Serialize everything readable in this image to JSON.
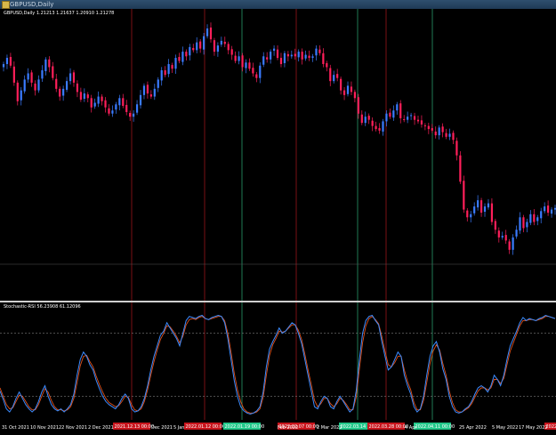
{
  "window": {
    "title": "GBPUSD,Daily"
  },
  "main_panel": {
    "header": "GBPUSD,Daily  1.21213 1.21637 1.20910 1.21278"
  },
  "sub_panel": {
    "header": "Stochastic-RSI 56.23908 61.12096"
  },
  "colors": {
    "bull": "#3a7bff",
    "bear": "#ff1f5a",
    "bg": "#000000",
    "stoch_main": "#3c8cff",
    "stoch_signal": "#e0521c",
    "vline_red": "#7a0f14",
    "vline_green": "#1f7a55",
    "tag_red": "#c8141c",
    "tag_green": "#22c88a"
  },
  "time_axis": {
    "labels": [
      "31 Oct 2021",
      "10 Nov 2021",
      "22 Nov 2021",
      "2 Dec 2021",
      "Dec 2021",
      "5 Jan",
      "Feb 2022",
      "2 Mar 2022",
      "4 Apr",
      "25 Apr 2022",
      "5 May 2022",
      "17 May 2022"
    ],
    "tags": [
      {
        "text": "2021.12.13 00:00",
        "color": "red"
      },
      {
        "text": "2022.01.12 00:00",
        "color": "red"
      },
      {
        "text": "2022.01.19 00:00",
        "color": "green"
      },
      {
        "text": "2022.02.07 00:00",
        "color": "red"
      },
      {
        "text": "2022.03.14 00:00",
        "color": "green"
      },
      {
        "text": "2022.03.28 00:00",
        "color": "red"
      },
      {
        "text": "2022.04.11 00:00",
        "color": "green"
      },
      {
        "text": "2022.05.25 00:00",
        "color": "red"
      }
    ]
  },
  "chart_data": [
    {
      "type": "candlestick",
      "symbol": "GBPUSD",
      "timeframe": "Daily",
      "last_bar": {
        "open": 1.21213,
        "high": 1.21637,
        "low": 1.2091,
        "close": 1.21278
      },
      "vertical_markers": [
        {
          "date": "2021.12.13",
          "color": "red"
        },
        {
          "date": "2022.01.12",
          "color": "red"
        },
        {
          "date": "2022.01.19",
          "color": "green"
        },
        {
          "date": "2022.02.07",
          "color": "red"
        },
        {
          "date": "2022.03.14",
          "color": "green"
        },
        {
          "date": "2022.03.28",
          "color": "red"
        },
        {
          "date": "2022.04.11",
          "color": "green"
        }
      ],
      "close_profile": [
        1.352,
        1.356,
        1.351,
        1.34,
        1.328,
        1.335,
        1.342,
        1.346,
        1.34,
        1.335,
        1.342,
        1.348,
        1.355,
        1.35,
        1.343,
        1.336,
        1.331,
        1.336,
        1.341,
        1.346,
        1.34,
        1.334,
        1.329,
        1.333,
        1.33,
        1.324,
        1.327,
        1.331,
        1.328,
        1.324,
        1.32,
        1.322,
        1.326,
        1.33,
        1.325,
        1.321,
        1.318,
        1.32,
        1.326,
        1.332,
        1.338,
        1.333,
        1.331,
        1.336,
        1.342,
        1.348,
        1.345,
        1.352,
        1.349,
        1.356,
        1.354,
        1.36,
        1.357,
        1.363,
        1.361,
        1.366,
        1.362,
        1.37,
        1.375,
        1.368,
        1.36,
        1.364,
        1.367,
        1.365,
        1.361,
        1.358,
        1.354,
        1.357,
        1.35,
        1.353,
        1.349,
        1.346,
        1.343,
        1.351,
        1.357,
        1.355,
        1.36,
        1.362,
        1.356,
        1.352,
        1.359,
        1.357,
        1.358,
        1.357,
        1.36,
        1.355,
        1.358,
        1.356,
        1.357,
        1.362,
        1.359,
        1.352,
        1.35,
        1.341,
        1.345,
        1.343,
        1.335,
        1.332,
        1.338,
        1.334,
        1.33,
        1.32,
        1.314,
        1.318,
        1.316,
        1.312,
        1.31,
        1.309,
        1.315,
        1.32,
        1.318,
        1.322,
        1.326,
        1.317,
        1.316,
        1.318,
        1.319,
        1.316,
        1.315,
        1.313,
        1.312,
        1.31,
        1.309,
        1.306,
        1.311,
        1.308,
        1.305,
        1.307,
        1.303,
        1.293,
        1.276,
        1.258,
        1.253,
        1.255,
        1.26,
        1.264,
        1.256,
        1.26,
        1.262,
        1.25,
        1.245,
        1.24,
        1.241,
        1.238,
        1.232,
        1.24,
        1.245,
        1.253,
        1.246,
        1.25,
        1.255,
        1.25,
        1.253,
        1.257,
        1.26,
        1.256,
        1.258,
        1.259
      ],
      "y_range": [
        1.225,
        1.375
      ]
    },
    {
      "type": "line",
      "indicator": "Stochastic-RSI",
      "values_shown": [
        56.23908,
        61.12096
      ],
      "levels": [
        80,
        20
      ],
      "ylim": [
        0,
        100
      ],
      "series": [
        {
          "color": "blue",
          "values": [
            25,
            17,
            8,
            5,
            10,
            18,
            24,
            18,
            12,
            8,
            5,
            8,
            15,
            24,
            30,
            20,
            12,
            8,
            6,
            8,
            5,
            8,
            12,
            22,
            40,
            55,
            62,
            58,
            50,
            45,
            35,
            27,
            20,
            15,
            12,
            10,
            8,
            12,
            18,
            22,
            18,
            8,
            5,
            6,
            10,
            18,
            30,
            45,
            58,
            68,
            78,
            82,
            90,
            85,
            80,
            75,
            68,
            80,
            92,
            96,
            95,
            94,
            96,
            97,
            94,
            93,
            95,
            96,
            97,
            96,
            90,
            75,
            55,
            35,
            20,
            10,
            6,
            4,
            3,
            4,
            6,
            10,
            24,
            48,
            65,
            72,
            78,
            85,
            80,
            82,
            86,
            90,
            88,
            80,
            70,
            55,
            40,
            25,
            10,
            8,
            15,
            20,
            18,
            10,
            8,
            15,
            20,
            15,
            10,
            5,
            8,
            25,
            55,
            80,
            92,
            96,
            97,
            92,
            88,
            72,
            58,
            45,
            48,
            55,
            62,
            58,
            40,
            30,
            22,
            10,
            5,
            8,
            20,
            40,
            58,
            68,
            72,
            62,
            46,
            36,
            20,
            10,
            5,
            4,
            5,
            8,
            10,
            15,
            22,
            28,
            30,
            28,
            24,
            30,
            40,
            36,
            30,
            40,
            55,
            68,
            75,
            82,
            90,
            95,
            92,
            94,
            93,
            92,
            94,
            95,
            97,
            96,
            95,
            94
          ]
        },
        {
          "color": "orange",
          "values": [
            28,
            20,
            12,
            8,
            9,
            15,
            21,
            20,
            15,
            10,
            7,
            7,
            12,
            20,
            27,
            24,
            16,
            10,
            7,
            7,
            6,
            7,
            10,
            18,
            33,
            49,
            58,
            59,
            53,
            48,
            39,
            31,
            24,
            18,
            14,
            12,
            10,
            11,
            15,
            20,
            19,
            12,
            7,
            6,
            8,
            15,
            26,
            40,
            53,
            64,
            74,
            80,
            87,
            86,
            82,
            77,
            71,
            77,
            88,
            93,
            94,
            93,
            95,
            96,
            94,
            93,
            94,
            95,
            96,
            96,
            92,
            80,
            62,
            42,
            26,
            15,
            8,
            5,
            4,
            4,
            5,
            8,
            19,
            40,
            59,
            69,
            75,
            82,
            81,
            82,
            85,
            88,
            88,
            83,
            74,
            60,
            45,
            31,
            16,
            10,
            13,
            18,
            18,
            13,
            10,
            13,
            18,
            16,
            12,
            7,
            7,
            19,
            46,
            71,
            87,
            94,
            96,
            93,
            89,
            77,
            63,
            50,
            48,
            52,
            58,
            58,
            45,
            34,
            26,
            14,
            7,
            7,
            16,
            33,
            51,
            63,
            69,
            64,
            51,
            40,
            25,
            14,
            7,
            5,
            5,
            7,
            9,
            13,
            19,
            25,
            28,
            28,
            26,
            28,
            36,
            36,
            32,
            37,
            50,
            63,
            71,
            79,
            87,
            92,
            92,
            93,
            93,
            92,
            93,
            94,
            96,
            96,
            95,
            94
          ]
        }
      ]
    }
  ]
}
